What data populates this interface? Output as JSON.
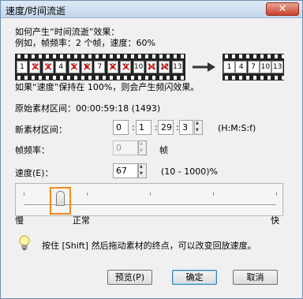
{
  "window": {
    "title": "速度/时间流逝",
    "close_glyph": "✕"
  },
  "description": {
    "line1": "如何产生“时间流逝”效果：",
    "line2": "例如，帧频率：2 个帧，速度：60%"
  },
  "illustration": {
    "before_frames": [
      {
        "label": "1",
        "crossed": false
      },
      {
        "label": "2",
        "crossed": true
      },
      {
        "label": "3",
        "crossed": true
      },
      {
        "label": "4",
        "crossed": false
      },
      {
        "label": "5",
        "crossed": true
      },
      {
        "label": "6",
        "crossed": true
      },
      {
        "label": "7",
        "crossed": false
      },
      {
        "label": "8",
        "crossed": true
      },
      {
        "label": "9",
        "crossed": true
      },
      {
        "label": "10",
        "crossed": false
      },
      {
        "label": "11",
        "crossed": true
      },
      {
        "label": "12",
        "crossed": true
      },
      {
        "label": "13",
        "crossed": false
      }
    ],
    "after_frames": [
      "1",
      "4",
      "7",
      "10",
      "13"
    ]
  },
  "warning_text": "如果“速度”保持在 100%，则会产生频闪效果。",
  "original_clip": {
    "label": "原始素材区间：",
    "value": "00:00:59:18 (1493)"
  },
  "new_clip": {
    "label": "新素材区间：",
    "hours": "0",
    "minutes": "1",
    "seconds": "29",
    "frames": "3",
    "format_hint": "(H:M:S:f)"
  },
  "frame_rate": {
    "label": "帧频率：",
    "value": "0",
    "unit": "帧"
  },
  "speed": {
    "label": "速度(E)：",
    "value": "67",
    "range": "(10 - 1000)%"
  },
  "slider": {
    "value_percent": 67,
    "label_slow": "慢",
    "label_normal": "正常",
    "label_fast": "快"
  },
  "tip": "按住 [Shift] 然后拖动素材的终点，可以改变回放速度。",
  "buttons": {
    "preview": "预览(P)",
    "ok": "确定",
    "cancel": "取消"
  },
  "colors": {
    "slider_focus": "#f28a1e",
    "cross": "#dd1111"
  }
}
